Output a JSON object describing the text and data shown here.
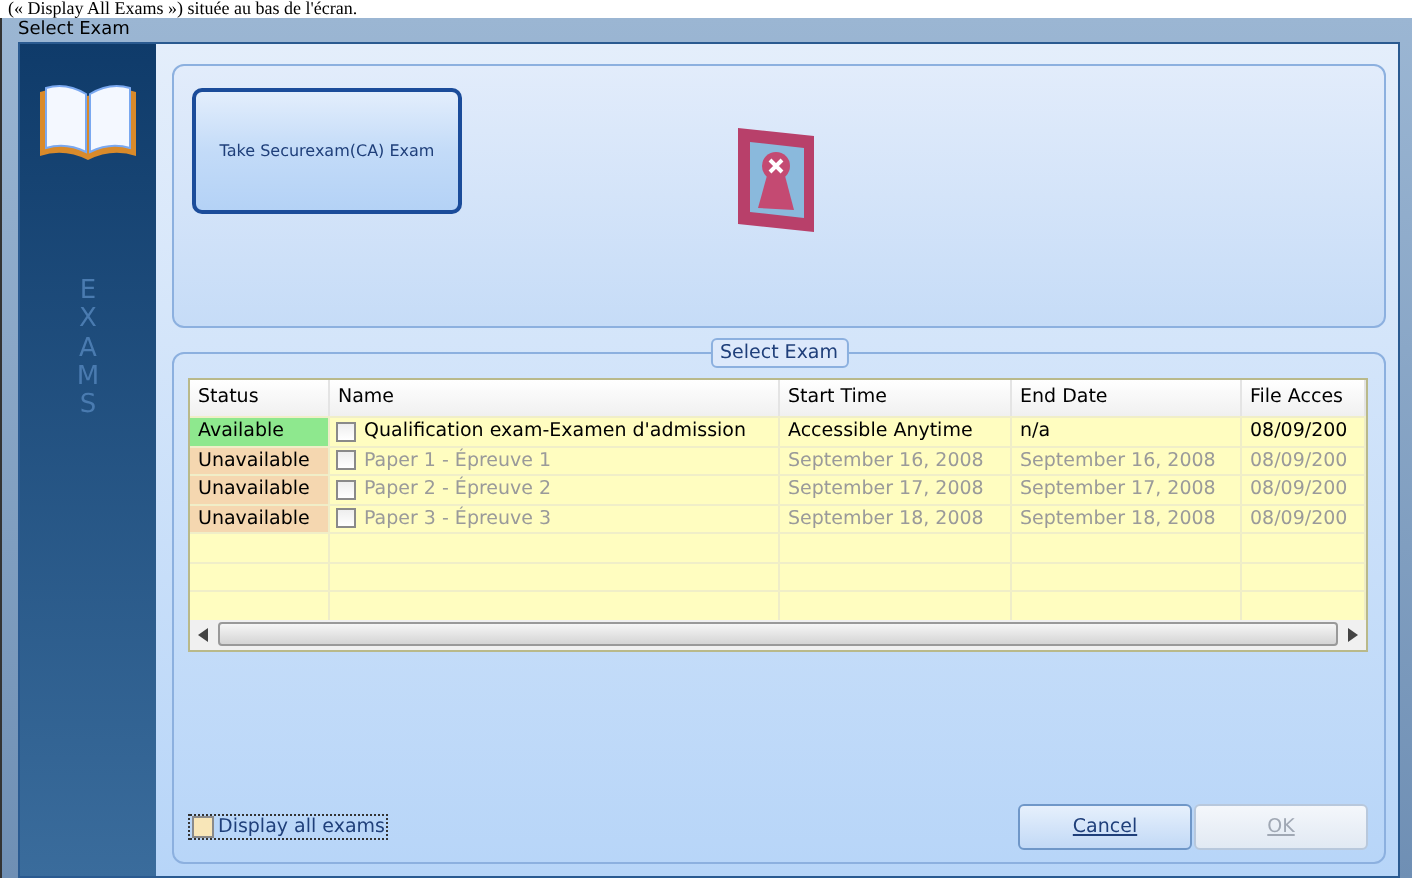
{
  "caption": "(« Display All Exams ») située au bas de l'écran.",
  "window": {
    "title": "Select Exam"
  },
  "sidebar": {
    "label": "EXAMS"
  },
  "take_exam_button": {
    "label": "Take Securexam(CA) Exam"
  },
  "exam_group": {
    "title": "Select Exam"
  },
  "table": {
    "columns": [
      "Status",
      "Name",
      "Start Time",
      "End Date",
      "File Acces"
    ],
    "rows": [
      {
        "status": "Available",
        "color": "#8ee88e",
        "disabled": false,
        "checked": false,
        "name": "Qualification exam-Examen d'admission",
        "start": "Accessible Anytime",
        "end": "n/a",
        "file_access": "08/09/200"
      },
      {
        "status": "Unavailable",
        "color": "#f5d7b0",
        "disabled": true,
        "checked": false,
        "name": "Paper 1 - Épreuve 1",
        "start": "September 16, 2008",
        "end": "September 16, 2008",
        "file_access": "08/09/200"
      },
      {
        "status": "Unavailable",
        "color": "#f5d7b0",
        "disabled": true,
        "checked": false,
        "name": "Paper 2 - Épreuve 2",
        "start": "September 17, 2008",
        "end": "September 17, 2008",
        "file_access": "08/09/200"
      },
      {
        "status": "Unavailable",
        "color": "#f5d7b0",
        "disabled": true,
        "checked": false,
        "name": "Paper 3 - Épreuve 3",
        "start": "September 18, 2008",
        "end": "September 18, 2008",
        "file_access": "08/09/200"
      }
    ]
  },
  "display_all": {
    "label": "Display all exams",
    "checked": false
  },
  "buttons": [
    {
      "label": "Cancel",
      "disabled": false
    },
    {
      "label": "OK",
      "disabled": true
    }
  ]
}
